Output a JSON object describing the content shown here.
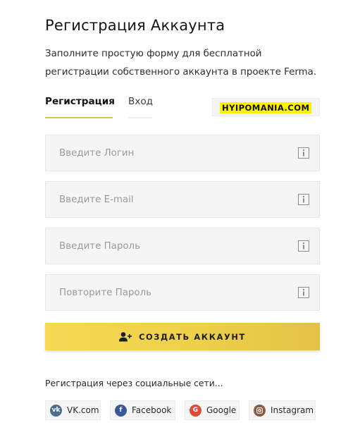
{
  "header": {
    "title": "Регистрация Аккаунта",
    "description": "Заполните простую форму для бесплатной регистрации собственного аккаунта в проекте Ferma."
  },
  "tabs": [
    {
      "label": "Регистрация",
      "active": true
    },
    {
      "label": "Вход",
      "active": false
    }
  ],
  "badge": {
    "text": "HYIPOMANIA.COM"
  },
  "form": {
    "login_placeholder": "Введите Логин",
    "email_placeholder": "Введите E-mail",
    "password_placeholder": "Введите Пароль",
    "password_repeat_placeholder": "Повторите Пароль",
    "submit_label": "СОЗДАТЬ АККАУНТ"
  },
  "social": {
    "caption": "Регистрация через социальные сети...",
    "buttons": [
      {
        "label": "VK.com",
        "icon": "vk-icon",
        "color": "#4c6c91"
      },
      {
        "label": "Facebook",
        "icon": "facebook-icon",
        "color": "#3b5998"
      },
      {
        "label": "Google",
        "icon": "google-icon",
        "color": "#dd4b39"
      },
      {
        "label": "Instagram",
        "icon": "instagram-icon",
        "color": "#8a5a44"
      }
    ]
  },
  "colors": {
    "accent": "#f2d24e",
    "badge_highlight": "#fff200",
    "field_background": "#f5f5f5"
  }
}
